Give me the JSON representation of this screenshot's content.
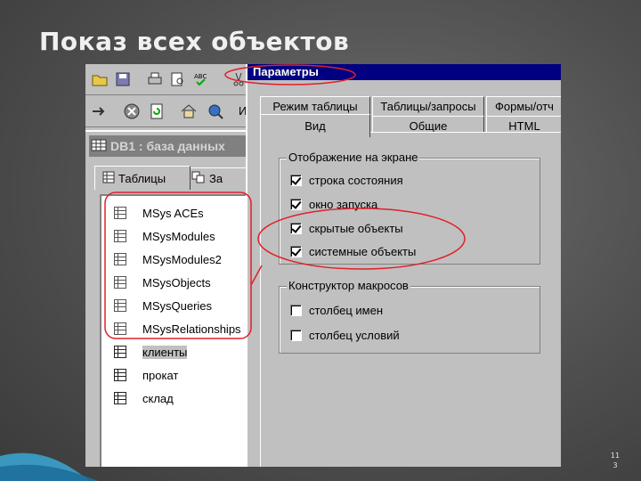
{
  "slide": {
    "title": "Показ всех объектов",
    "page_number_line1": "11",
    "page_number_line2": "3"
  },
  "toolbar": {
    "row2_label": "И",
    "row1_icons": [
      "open-icon",
      "save-icon",
      "print-icon",
      "print-preview-icon",
      "spelling-icon",
      "cut-icon"
    ],
    "row2_icons": [
      "arrow-icon",
      "stop-icon",
      "refresh-icon",
      "home-icon",
      "search-web-icon"
    ]
  },
  "db_window": {
    "title": "DB1 : база данных",
    "tabs": [
      {
        "label": "Таблицы",
        "active": true
      },
      {
        "label": "За"
      }
    ],
    "items": [
      {
        "label": "MSys ACEs"
      },
      {
        "label": "MSysModules"
      },
      {
        "label": "MSysModules2"
      },
      {
        "label": "MSysObjects"
      },
      {
        "label": "MSysQueries"
      },
      {
        "label": "MSysRelationships"
      },
      {
        "label": "клиенты",
        "selected": true
      },
      {
        "label": "прокат"
      },
      {
        "label": "склад"
      }
    ]
  },
  "dialog": {
    "title": "Параметры",
    "tabs_row1": [
      "Режим таблицы",
      "Таблицы/запросы",
      "Формы/отч"
    ],
    "tabs_row2": [
      "Вид",
      "Общие",
      "HTML"
    ],
    "groups": [
      {
        "label": "Отображение на экране",
        "options": [
          {
            "label": "строка состояния",
            "checked": true
          },
          {
            "label": "окно запуска",
            "checked": true
          },
          {
            "label": "скрытые объекты",
            "checked": true
          },
          {
            "label": "системные объекты",
            "checked": true
          }
        ]
      },
      {
        "label": "Конструктор макросов",
        "options": [
          {
            "label": "столбец имен",
            "checked": false
          },
          {
            "label": "столбец условий",
            "checked": false
          }
        ]
      }
    ]
  },
  "colors": {
    "annotation": "#e0202a",
    "dialog_caption": "#000080",
    "accent_wave": "#3aa7d4"
  }
}
